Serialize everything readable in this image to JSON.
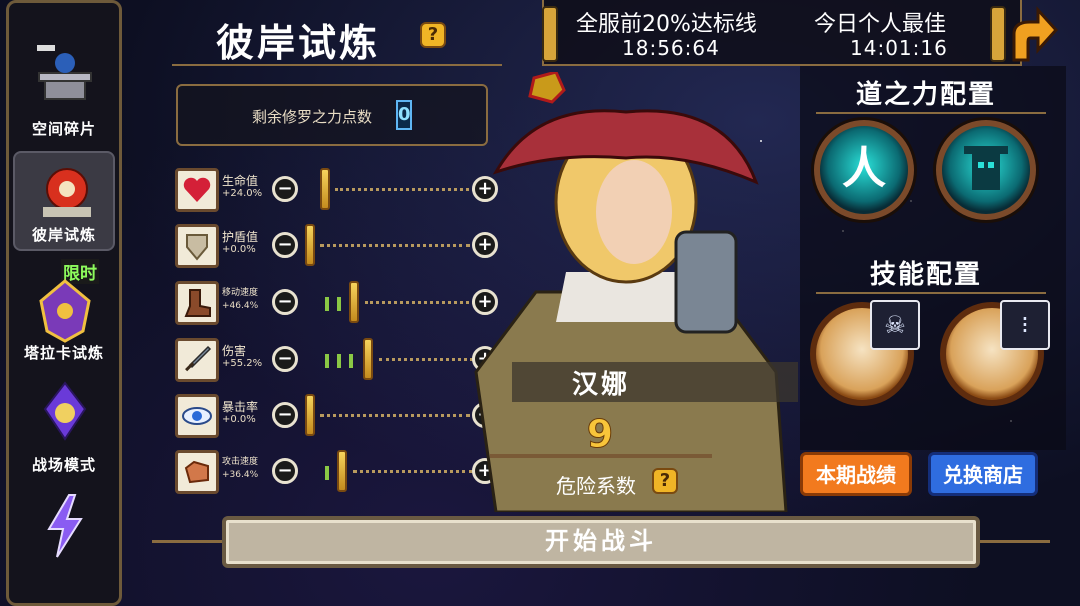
{
  "sidebar": {
    "items": [
      {
        "label": "空间碎片"
      },
      {
        "label": "彼岸试炼"
      },
      {
        "label": "塔拉卡试炼",
        "badge": "限时"
      },
      {
        "label": "战场模式"
      },
      {
        "label": ""
      }
    ]
  },
  "title": "彼岸试炼",
  "help_icon": "?",
  "points": {
    "label": "剩余修罗之力点数",
    "value": "0"
  },
  "stats": [
    {
      "name": "生命值",
      "value": "+24.0%",
      "icon": "heart-icon"
    },
    {
      "name": "护盾值",
      "value": "+0.0%",
      "icon": "shield-icon"
    },
    {
      "name": "移动速度",
      "value": "+46.4%",
      "icon": "boot-icon"
    },
    {
      "name": "伤害",
      "value": "+55.2%",
      "icon": "sword-icon"
    },
    {
      "name": "暴击率",
      "value": "+0.0%",
      "icon": "eye-icon"
    },
    {
      "name": "攻击速度",
      "value": "+36.4%",
      "icon": "fist-icon"
    }
  ],
  "records": {
    "server_label": "全服前20%达标线",
    "server_time": "18:56:64",
    "personal_label": "今日个人最佳",
    "personal_time": "14:01:16"
  },
  "character": {
    "name": "汉娜",
    "danger_value": "9",
    "danger_label": "危险系数"
  },
  "right_panel": {
    "dao_title": "道之力配置",
    "skill_title": "技能配置",
    "dao_glyph": "人",
    "season_button": "本期战绩",
    "shop_button": "兑换商店"
  },
  "start_button": "开始战斗",
  "colors": {
    "accent_gold": "#f0b526",
    "orb_teal": "#2ae0d8",
    "frame_brown": "#8a6c40",
    "shop_blue": "#2f6de0",
    "season_orange": "#f27a1e"
  }
}
